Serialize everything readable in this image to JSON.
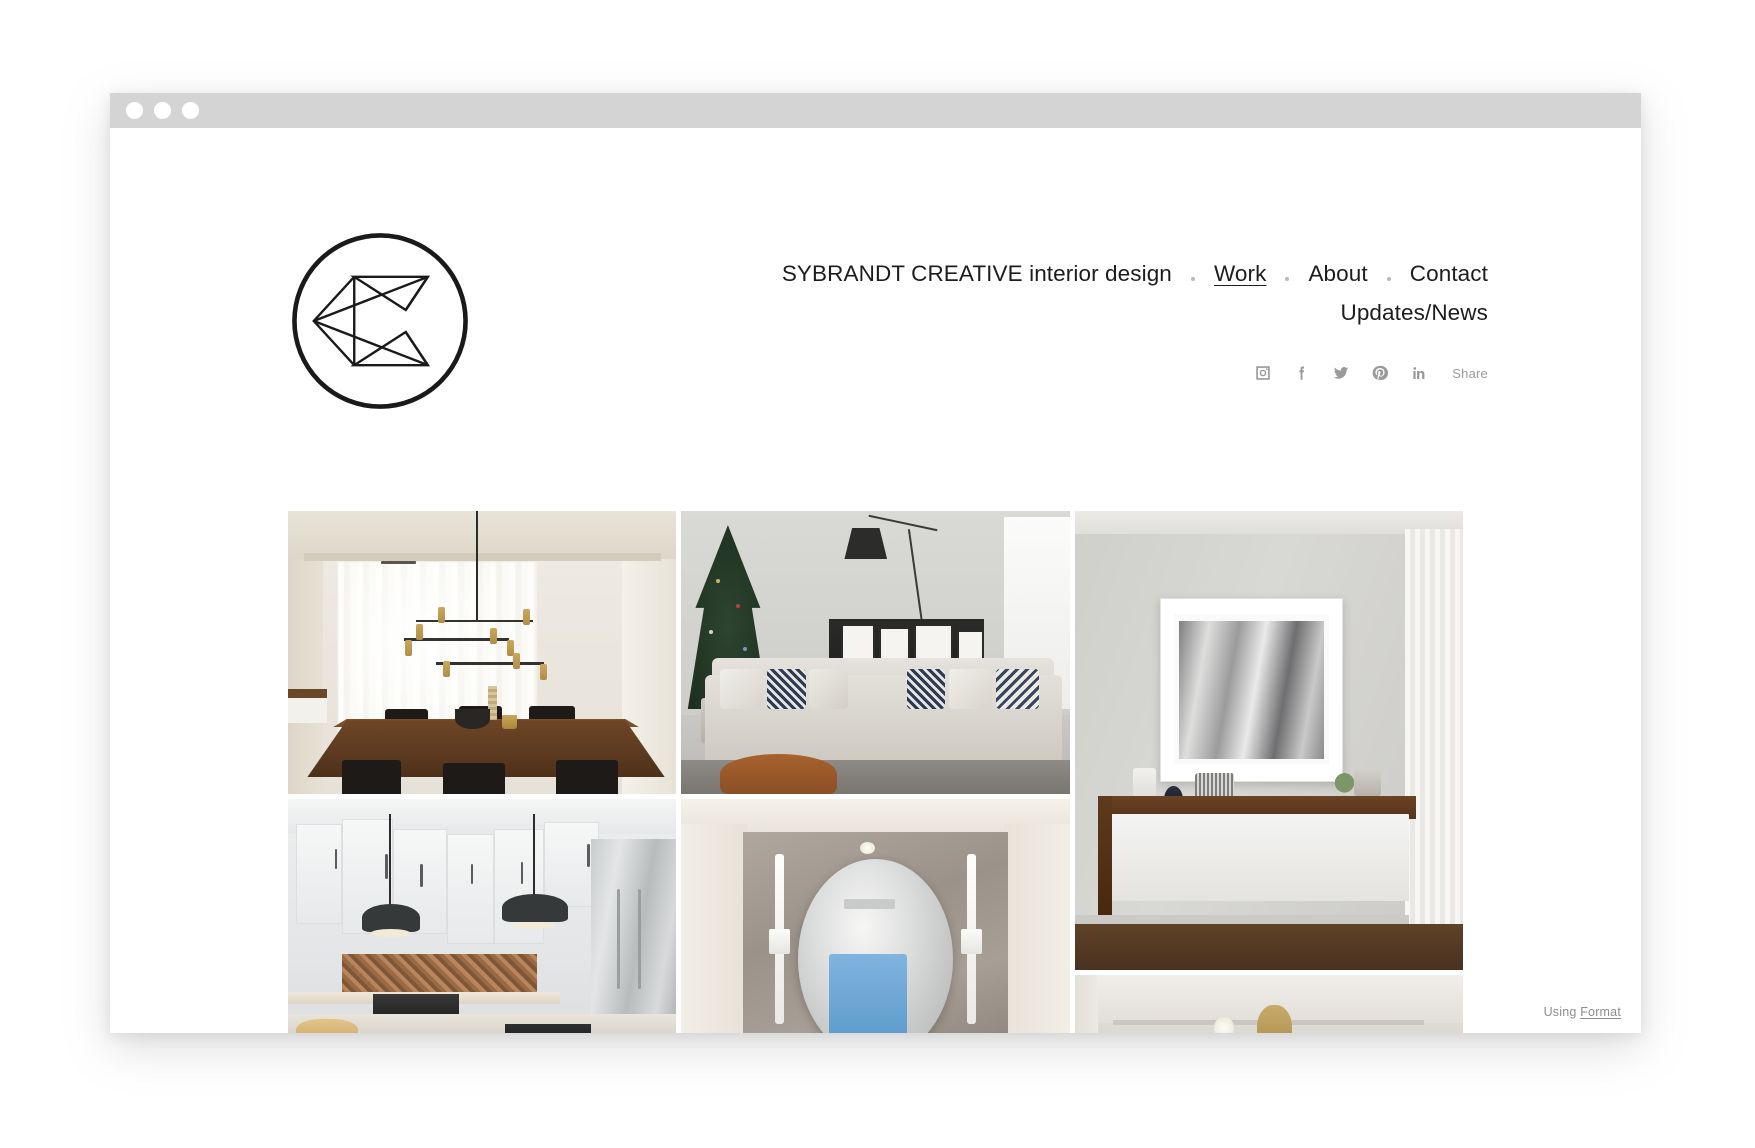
{
  "window": {
    "traffic_lights": [
      "close-dot",
      "minimize-dot",
      "maximize-dot"
    ]
  },
  "header": {
    "logo_alt": "Sybrandt Creative monogram C logo",
    "brand_title": "SYBRANDT CREATIVE interior design",
    "nav": [
      {
        "label": "Work",
        "active": true
      },
      {
        "label": "About",
        "active": false
      },
      {
        "label": "Contact",
        "active": false
      }
    ],
    "nav_line2": [
      {
        "label": "Updates/News",
        "active": false
      }
    ],
    "social": [
      {
        "name": "instagram-icon"
      },
      {
        "name": "facebook-icon"
      },
      {
        "name": "twitter-icon"
      },
      {
        "name": "pinterest-icon"
      },
      {
        "name": "linkedin-icon"
      }
    ],
    "share_label": "Share"
  },
  "gallery": {
    "columns": [
      {
        "tiles": [
          {
            "alt": "Dining room with brass linear chandelier, walnut table and black chairs",
            "scene": "dining"
          },
          {
            "alt": "White kitchen with black dome pendant lights, copper herringbone backsplash and stainless refrigerator",
            "scene": "kitchen"
          }
        ]
      },
      {
        "tiles": [
          {
            "alt": "Living room with decorated Christmas tree, sectional sofa and arc floor lamp",
            "scene": "living"
          },
          {
            "alt": "Powder room with round mirror flanked by vertical LED sconces on stone panel",
            "scene": "bath"
          }
        ]
      },
      {
        "tiles": [
          {
            "alt": "Floating walnut credenza with white drawer below large framed black and white photograph",
            "scene": "console"
          },
          {
            "alt": "Ceiling detail with brass pendant and recessed downlight",
            "scene": "ceiling"
          }
        ]
      }
    ]
  },
  "footer": {
    "prefix": "Using ",
    "link_label": "Format"
  },
  "colors": {
    "titlebar": "#d4d4d4",
    "text": "#1d1d1d",
    "muted": "#9a9a9a",
    "page": "#ffffff"
  }
}
